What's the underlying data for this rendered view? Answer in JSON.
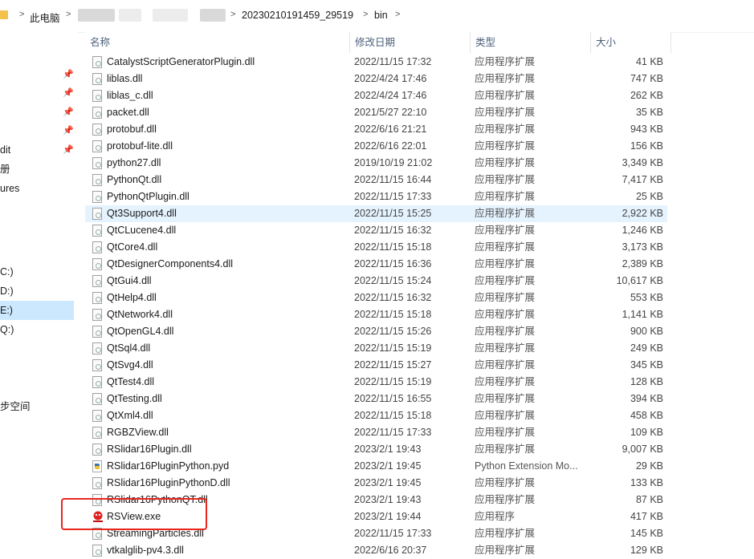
{
  "breadcrumb": {
    "root": "此电脑",
    "folder": "20230210191459_29519",
    "current": "bin",
    "separator": ">"
  },
  "nav": {
    "items": [
      {
        "label": "dit",
        "pinned": true
      },
      {
        "label": "册",
        "pinned": false
      },
      {
        "label": "ures",
        "pinned": false
      },
      {
        "label": "C:)",
        "selected": false
      },
      {
        "label": "D:)",
        "selected": false
      },
      {
        "label": "E:)",
        "selected": true
      },
      {
        "label": "Q:)",
        "selected": false
      },
      {
        "label": "步空间",
        "selected": false
      }
    ]
  },
  "columns": {
    "name": "名称",
    "date": "修改日期",
    "type": "类型",
    "size": "大小"
  },
  "files": [
    {
      "name": "CatalystScriptGeneratorPlugin.dll",
      "date": "2022/11/15 17:32",
      "type": "应用程序扩展",
      "size": "41 KB",
      "icon": "dll-file-icon"
    },
    {
      "name": "liblas.dll",
      "date": "2022/4/24 17:46",
      "type": "应用程序扩展",
      "size": "747 KB",
      "icon": "dll-file-icon"
    },
    {
      "name": "liblas_c.dll",
      "date": "2022/4/24 17:46",
      "type": "应用程序扩展",
      "size": "262 KB",
      "icon": "dll-file-icon"
    },
    {
      "name": "packet.dll",
      "date": "2021/5/27 22:10",
      "type": "应用程序扩展",
      "size": "35 KB",
      "icon": "dll-file-icon"
    },
    {
      "name": "protobuf.dll",
      "date": "2022/6/16 21:21",
      "type": "应用程序扩展",
      "size": "943 KB",
      "icon": "dll-file-icon"
    },
    {
      "name": "protobuf-lite.dll",
      "date": "2022/6/16 22:01",
      "type": "应用程序扩展",
      "size": "156 KB",
      "icon": "dll-file-icon"
    },
    {
      "name": "python27.dll",
      "date": "2019/10/19 21:02",
      "type": "应用程序扩展",
      "size": "3,349 KB",
      "icon": "dll-file-icon"
    },
    {
      "name": "PythonQt.dll",
      "date": "2022/11/15 16:44",
      "type": "应用程序扩展",
      "size": "7,417 KB",
      "icon": "dll-file-icon"
    },
    {
      "name": "PythonQtPlugin.dll",
      "date": "2022/11/15 17:33",
      "type": "应用程序扩展",
      "size": "25 KB",
      "icon": "dll-file-icon"
    },
    {
      "name": "Qt3Support4.dll",
      "date": "2022/11/15 15:25",
      "type": "应用程序扩展",
      "size": "2,922 KB",
      "icon": "dll-file-icon",
      "hover": true
    },
    {
      "name": "QtCLucene4.dll",
      "date": "2022/11/15 16:32",
      "type": "应用程序扩展",
      "size": "1,246 KB",
      "icon": "dll-file-icon"
    },
    {
      "name": "QtCore4.dll",
      "date": "2022/11/15 15:18",
      "type": "应用程序扩展",
      "size": "3,173 KB",
      "icon": "dll-file-icon"
    },
    {
      "name": "QtDesignerComponents4.dll",
      "date": "2022/11/15 16:36",
      "type": "应用程序扩展",
      "size": "2,389 KB",
      "icon": "dll-file-icon"
    },
    {
      "name": "QtGui4.dll",
      "date": "2022/11/15 15:24",
      "type": "应用程序扩展",
      "size": "10,617 KB",
      "icon": "dll-file-icon"
    },
    {
      "name": "QtHelp4.dll",
      "date": "2022/11/15 16:32",
      "type": "应用程序扩展",
      "size": "553 KB",
      "icon": "dll-file-icon"
    },
    {
      "name": "QtNetwork4.dll",
      "date": "2022/11/15 15:18",
      "type": "应用程序扩展",
      "size": "1,141 KB",
      "icon": "dll-file-icon"
    },
    {
      "name": "QtOpenGL4.dll",
      "date": "2022/11/15 15:26",
      "type": "应用程序扩展",
      "size": "900 KB",
      "icon": "dll-file-icon"
    },
    {
      "name": "QtSql4.dll",
      "date": "2022/11/15 15:19",
      "type": "应用程序扩展",
      "size": "249 KB",
      "icon": "dll-file-icon"
    },
    {
      "name": "QtSvg4.dll",
      "date": "2022/11/15 15:27",
      "type": "应用程序扩展",
      "size": "345 KB",
      "icon": "dll-file-icon"
    },
    {
      "name": "QtTest4.dll",
      "date": "2022/11/15 15:19",
      "type": "应用程序扩展",
      "size": "128 KB",
      "icon": "dll-file-icon"
    },
    {
      "name": "QtTesting.dll",
      "date": "2022/11/15 16:55",
      "type": "应用程序扩展",
      "size": "394 KB",
      "icon": "dll-file-icon"
    },
    {
      "name": "QtXml4.dll",
      "date": "2022/11/15 15:18",
      "type": "应用程序扩展",
      "size": "458 KB",
      "icon": "dll-file-icon"
    },
    {
      "name": "RGBZView.dll",
      "date": "2022/11/15 17:33",
      "type": "应用程序扩展",
      "size": "109 KB",
      "icon": "dll-file-icon"
    },
    {
      "name": "RSlidar16Plugin.dll",
      "date": "2023/2/1 19:43",
      "type": "应用程序扩展",
      "size": "9,007 KB",
      "icon": "dll-file-icon"
    },
    {
      "name": "RSlidar16PluginPython.pyd",
      "date": "2023/2/1 19:45",
      "type": "Python Extension Mo...",
      "size": "29 KB",
      "icon": "python-file-icon"
    },
    {
      "name": "RSlidar16PluginPythonD.dll",
      "date": "2023/2/1 19:45",
      "type": "应用程序扩展",
      "size": "133 KB",
      "icon": "dll-file-icon"
    },
    {
      "name": "RSlidar16PythonQT.dll",
      "date": "2023/2/1 19:43",
      "type": "应用程序扩展",
      "size": "87 KB",
      "icon": "dll-file-icon"
    },
    {
      "name": "RSView.exe",
      "date": "2023/2/1 19:44",
      "type": "应用程序",
      "size": "417 KB",
      "icon": "rsview-app-icon"
    },
    {
      "name": "StreamingParticles.dll",
      "date": "2022/11/15 17:33",
      "type": "应用程序扩展",
      "size": "145 KB",
      "icon": "dll-file-icon"
    },
    {
      "name": "vtkalglib-pv4.3.dll",
      "date": "2022/6/16 20:37",
      "type": "应用程序扩展",
      "size": "129 KB",
      "icon": "dll-file-icon"
    }
  ],
  "colors": {
    "selection": "#cce8ff",
    "hover": "#e5f3ff",
    "highlight_box": "#e8261c",
    "header_text": "#4c607a"
  }
}
